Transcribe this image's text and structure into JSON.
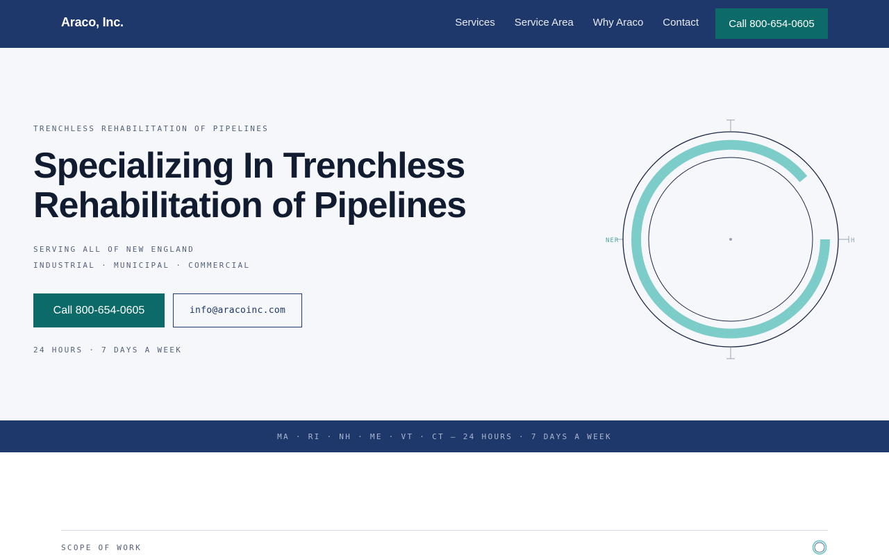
{
  "nav": {
    "brand": "Araco, Inc.",
    "links": [
      "Services",
      "Service Area",
      "Why Araco",
      "Contact"
    ],
    "cta": "Call 800-654-0605"
  },
  "hero": {
    "eyebrow": "TRENCHLESS REHABILITATION OF PIPELINES",
    "headline_line1": "Specializing In Trenchless",
    "headline_line2": "Rehabilitation of Pipelines",
    "sub1": "SERVING ALL OF NEW ENGLAND",
    "sub2": "INDUSTRIAL · MUNICIPAL · COMMERCIAL",
    "call_button": "Call 800-654-0605",
    "email_button": "info@aracoinc.com",
    "hours": "24 HOURS · 7 DAYS A WEEK",
    "diagram": {
      "left_label": "NER",
      "right_label": "H",
      "ring_color": "#1b2545",
      "liner_color": "#7cccca"
    }
  },
  "ribbon": {
    "text": "MA · RI · NH · ME · VT · CT — 24 HOURS · 7 DAYS A WEEK"
  },
  "scope": {
    "label": "SCOPE OF WORK"
  },
  "colors": {
    "navy": "#1f386b",
    "teal": "#0c6b68",
    "accent": "#7cccca",
    "hero_bg": "#f5f7fa"
  }
}
